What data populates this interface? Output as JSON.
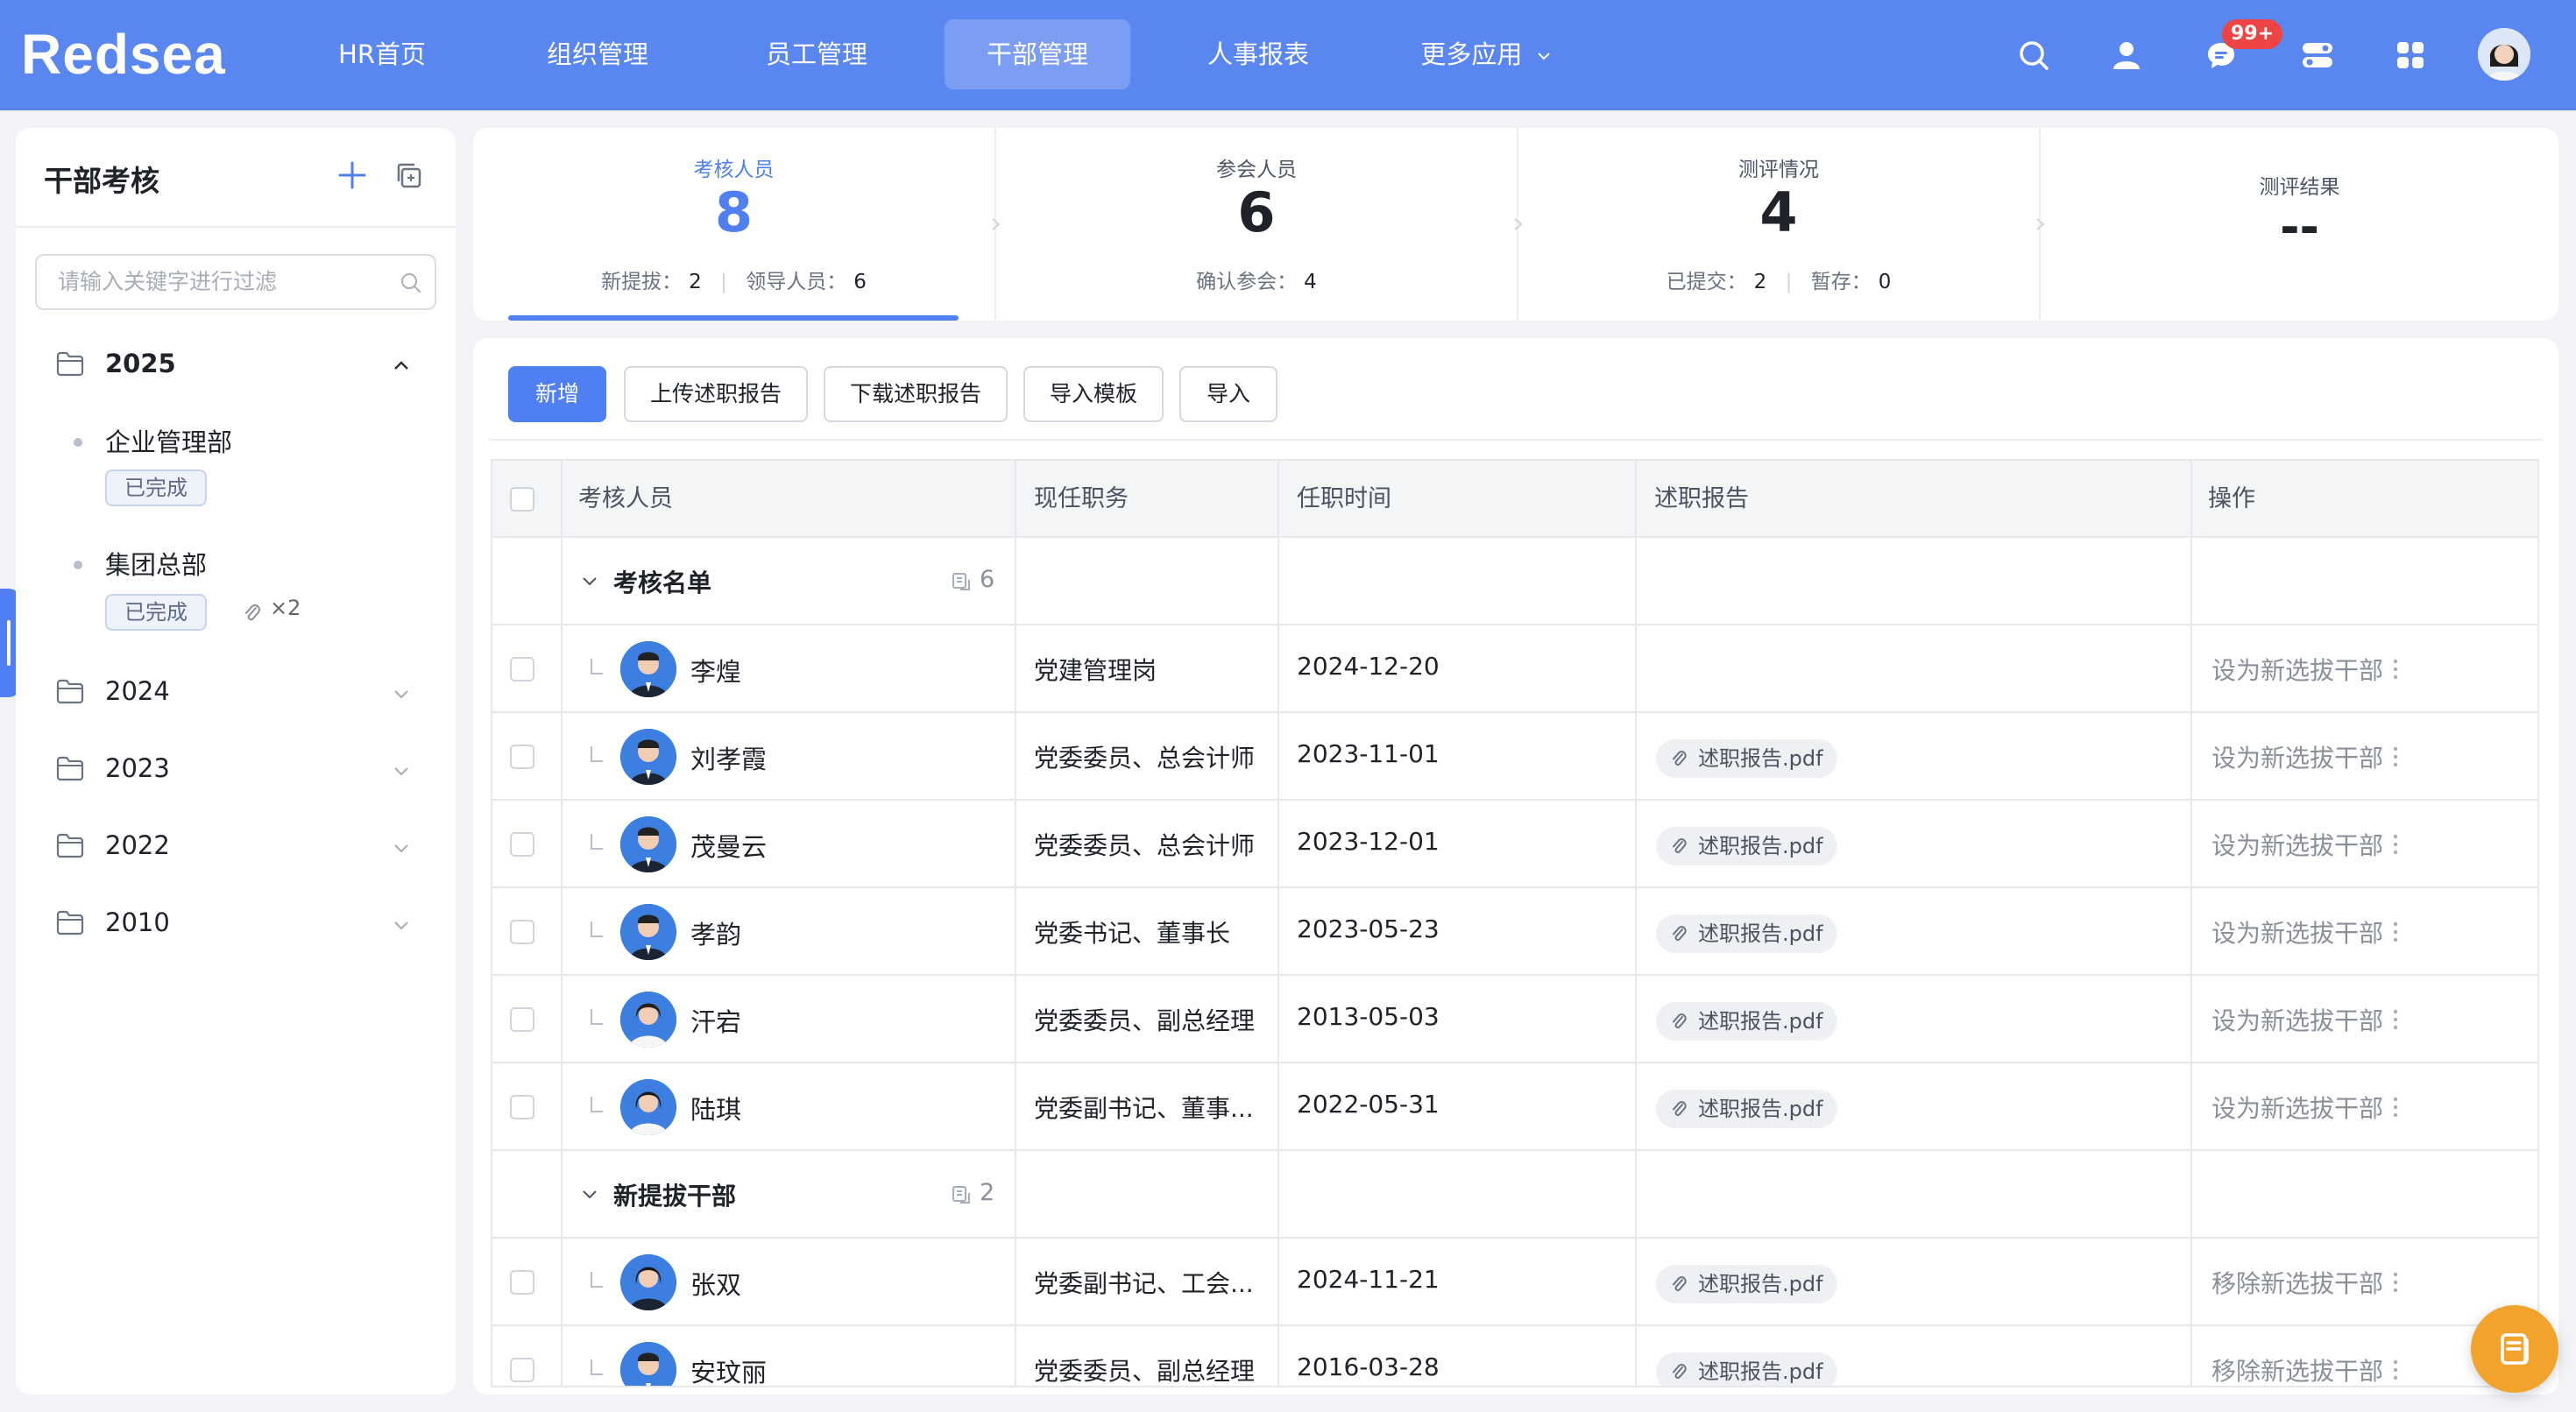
{
  "header": {
    "brand": "Redsea",
    "nav": [
      "HR首页",
      "组织管理",
      "员工管理",
      "干部管理",
      "人事报表",
      "更多应用"
    ],
    "active_nav": "干部管理",
    "notification_badge": "99+"
  },
  "sidebar": {
    "title": "干部考核",
    "search_placeholder": "请输入关键字进行过滤",
    "years": [
      {
        "label": "2025",
        "expanded": true,
        "depts": [
          {
            "name": "企业管理部",
            "status": "已完成"
          },
          {
            "name": "集团总部",
            "status": "已完成",
            "attachments": "×2"
          }
        ]
      },
      {
        "label": "2024",
        "expanded": false
      },
      {
        "label": "2023",
        "expanded": false
      },
      {
        "label": "2022",
        "expanded": false
      },
      {
        "label": "2010",
        "expanded": false
      }
    ]
  },
  "stats": [
    {
      "title": "考核人员",
      "value": "8",
      "sub": [
        {
          "label": "新提拔：",
          "value": "2"
        },
        {
          "label": "领导人员：",
          "value": "6"
        }
      ],
      "active": true
    },
    {
      "title": "参会人员",
      "value": "6",
      "sub": [
        {
          "label": "确认参会：",
          "value": "4"
        }
      ]
    },
    {
      "title": "测评情况",
      "value": "4",
      "sub": [
        {
          "label": "已提交：",
          "value": "2"
        },
        {
          "label": "暂存：",
          "value": "0"
        }
      ]
    },
    {
      "title": "测评结果",
      "value": "--"
    }
  ],
  "toolbar": {
    "add": "新增",
    "upload": "上传述职报告",
    "download": "下载述职报告",
    "template": "导入模板",
    "import": "导入"
  },
  "table": {
    "columns": [
      "考核人员",
      "现任职务",
      "任职时间",
      "述职报告",
      "操作"
    ],
    "groups": [
      {
        "name": "考核名单",
        "count": "6",
        "rows": [
          {
            "name": "李煌",
            "position": "党建管理岗",
            "date": "2024-12-20",
            "report": "",
            "action": "设为新选拔干部"
          },
          {
            "name": "刘孝霞",
            "position": "党委委员、总会计师",
            "date": "2023-11-01",
            "report": "述职报告.pdf",
            "action": "设为新选拔干部"
          },
          {
            "name": "茂曼云",
            "position": "党委委员、总会计师",
            "date": "2023-12-01",
            "report": "述职报告.pdf",
            "action": "设为新选拔干部"
          },
          {
            "name": "孝韵",
            "position": "党委书记、董事长",
            "date": "2023-05-23",
            "report": "述职报告.pdf",
            "action": "设为新选拔干部"
          },
          {
            "name": "汗宕",
            "position": "党委委员、副总经理",
            "date": "2013-05-03",
            "report": "述职报告.pdf",
            "action": "设为新选拔干部"
          },
          {
            "name": "陆琪",
            "position": "党委副书记、董事...",
            "date": "2022-05-31",
            "report": "述职报告.pdf",
            "action": "设为新选拔干部"
          }
        ]
      },
      {
        "name": "新提拔干部",
        "count": "2",
        "rows": [
          {
            "name": "张双",
            "position": "党委副书记、工会...",
            "date": "2024-11-21",
            "report": "述职报告.pdf",
            "action": "移除新选拔干部"
          },
          {
            "name": "安玟丽",
            "position": "党委委员、副总经理",
            "date": "2016-03-28",
            "report": "述职报告.pdf",
            "action": "移除新选拔干部"
          }
        ]
      }
    ]
  },
  "colors": {
    "primary": "#4f7ff0",
    "topbar": "#5a86f0",
    "badge": "#ee4444",
    "fab": "#f2a32c"
  }
}
